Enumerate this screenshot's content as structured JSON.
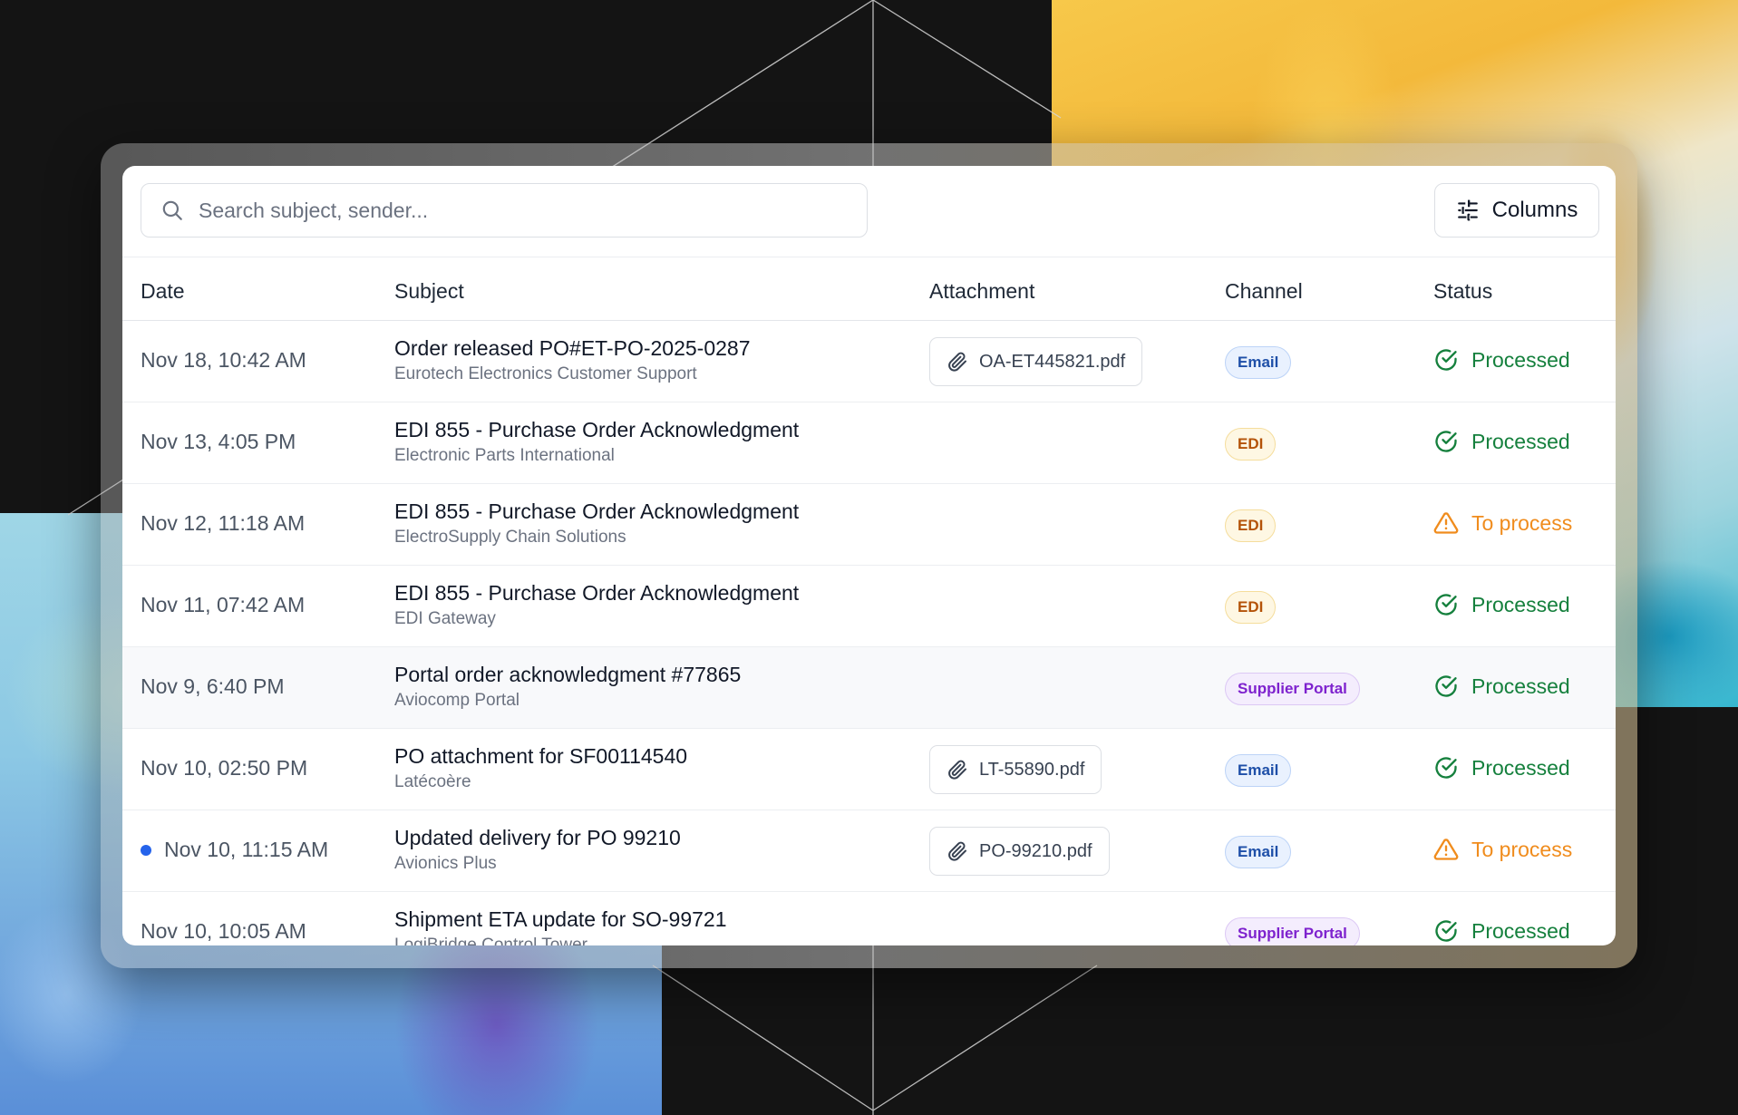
{
  "search": {
    "placeholder": "Search subject, sender..."
  },
  "toolbar": {
    "columns_label": "Columns"
  },
  "table": {
    "headers": {
      "date": "Date",
      "subject": "Subject",
      "attachment": "Attachment",
      "channel": "Channel",
      "status": "Status"
    },
    "rows": [
      {
        "date": "Nov 18, 10:42 AM",
        "subject": "Order released PO#ET-PO-2025-0287",
        "sender": "Eurotech Electronics Customer Support",
        "attachment": "OA-ET445821.pdf",
        "channel": "Email",
        "status": "Processed"
      },
      {
        "date": "Nov 13, 4:05 PM",
        "subject": "EDI 855 - Purchase Order Acknowledgment",
        "sender": "Electronic Parts International",
        "attachment": "",
        "channel": "EDI",
        "status": "Processed"
      },
      {
        "date": "Nov 12, 11:18 AM",
        "subject": "EDI 855 - Purchase Order Acknowledgment",
        "sender": "ElectroSupply Chain Solutions",
        "attachment": "",
        "channel": "EDI",
        "status": "To process"
      },
      {
        "date": "Nov 11, 07:42 AM",
        "subject": "EDI 855 - Purchase Order Acknowledgment",
        "sender": "EDI Gateway",
        "attachment": "",
        "channel": "EDI",
        "status": "Processed"
      },
      {
        "date": "Nov 9, 6:40 PM",
        "subject": "Portal order acknowledgment #77865",
        "sender": "Aviocomp Portal",
        "attachment": "",
        "channel": "Supplier Portal",
        "status": "Processed"
      },
      {
        "date": "Nov 10, 02:50 PM",
        "subject": "PO attachment for SF00114540",
        "sender": "Latécoère",
        "attachment": "LT-55890.pdf",
        "channel": "Email",
        "status": "Processed"
      },
      {
        "date": "Nov 10, 11:15 AM",
        "subject": "Updated delivery for PO 99210",
        "sender": "Avionics Plus",
        "attachment": "PO-99210.pdf",
        "channel": "Email",
        "status": "To process",
        "unread": true
      },
      {
        "date": "Nov 10, 10:05 AM",
        "subject": "Shipment ETA update for SO-99721",
        "sender": "LogiBridge Control Tower",
        "attachment": "",
        "channel": "Supplier Portal",
        "status": "Processed"
      }
    ]
  },
  "colors": {
    "processed": "#15803d",
    "to_process": "#f08c1d",
    "email_badge": "#1e4fa8",
    "edi_badge": "#b45309",
    "portal_badge": "#7e22ce",
    "unread_dot": "#2563eb"
  },
  "icons": {
    "search": "search-icon",
    "columns": "sliders-icon",
    "attachment": "paperclip-icon",
    "processed": "check-circle-icon",
    "to_process": "warning-triangle-icon"
  }
}
